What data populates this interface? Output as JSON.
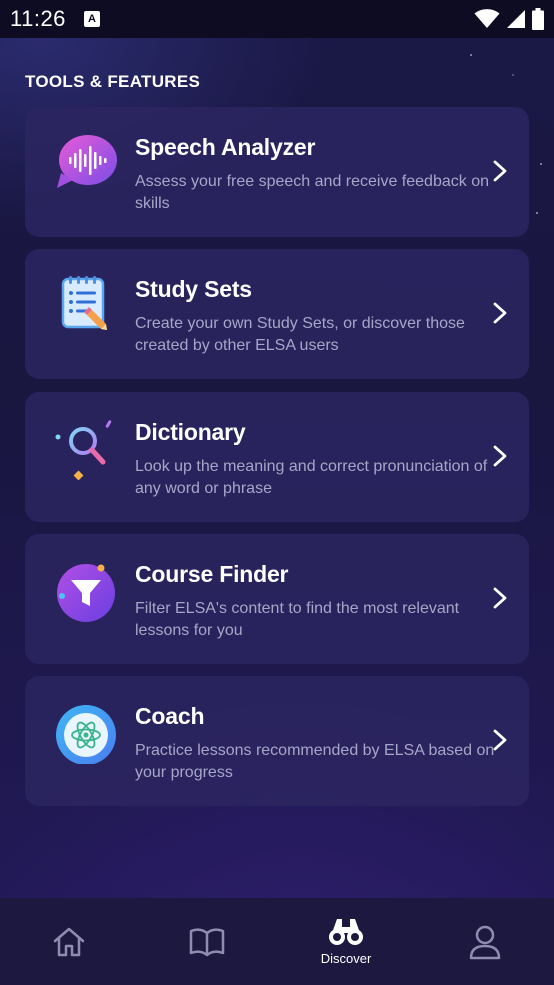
{
  "status_bar": {
    "time": "11:26",
    "badge": "A",
    "icons": [
      "wifi-icon",
      "signal-icon",
      "battery-icon"
    ]
  },
  "section_title": "TOOLS & FEATURES",
  "features": [
    {
      "title": "Speech Analyzer",
      "description": "Assess your free speech and receive feedback on skills",
      "icon": "speech-bubble-waveform-icon"
    },
    {
      "title": "Study Sets",
      "description": "Create your own Study Sets, or discover those created by other ELSA users",
      "icon": "notepad-pencil-icon"
    },
    {
      "title": "Dictionary",
      "description": "Look up the meaning and correct pronunciation of any word or phrase",
      "icon": "magnifier-icon"
    },
    {
      "title": "Course Finder",
      "description": "Filter ELSA's content to find the most relevant lessons for you",
      "icon": "funnel-icon"
    },
    {
      "title": "Coach",
      "description": "Practice lessons recommended by ELSA based on your progress",
      "icon": "atom-icon"
    }
  ],
  "bottom_nav": {
    "items": [
      {
        "icon": "home-icon",
        "label": ""
      },
      {
        "icon": "book-icon",
        "label": ""
      },
      {
        "icon": "binoculars-icon",
        "label": "Discover"
      },
      {
        "icon": "profile-icon",
        "label": ""
      }
    ],
    "active_index": 2
  },
  "colors": {
    "background": "#191640",
    "card": "#2c2660",
    "text_primary": "#ffffff",
    "text_secondary": "#a8a6c8",
    "status_bar": "#0d0c22",
    "nav_bar": "#1c1840"
  }
}
